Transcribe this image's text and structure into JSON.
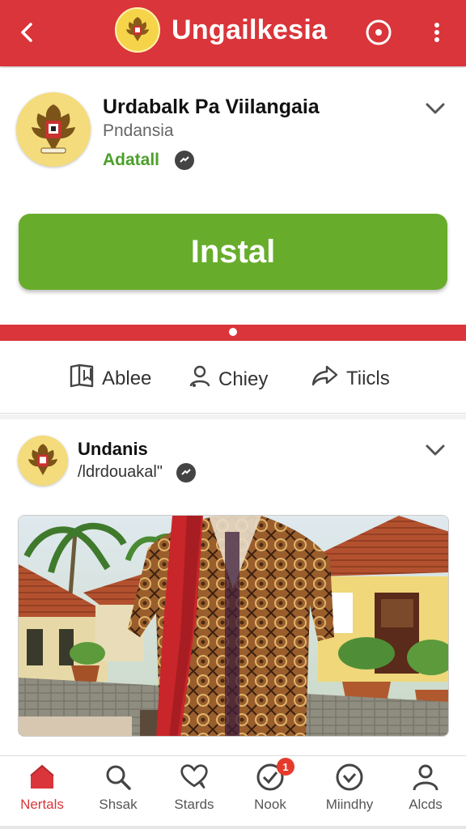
{
  "appbar": {
    "title": "Ungailkesia",
    "icons": [
      "back-arrow-icon",
      "garuda-emblem-icon",
      "record-icon",
      "more-vertical-icon"
    ]
  },
  "app": {
    "name": "Urdabalk Pa Viilangaia",
    "publisher": "Pndansia",
    "status": "Adatall",
    "install_label": "Instal"
  },
  "actions": [
    {
      "label": "Ablee",
      "icon": "bookmark-icon"
    },
    {
      "label": "Chiey",
      "icon": "person-icon"
    },
    {
      "label": "Tiicls",
      "icon": "share-icon"
    }
  ],
  "post": {
    "author": "Undanis",
    "handle": "/ldrdouakal\"",
    "image": "batik-shirt-photo"
  },
  "nav": {
    "items": [
      {
        "label": "Nertals",
        "icon": "home-icon",
        "active": true
      },
      {
        "label": "Shsak",
        "icon": "search-icon"
      },
      {
        "label": "Stards",
        "icon": "heart-chat-icon"
      },
      {
        "label": "Nook",
        "icon": "check-circle-icon",
        "badge": "1"
      },
      {
        "label": "Miindhy",
        "icon": "check-circle-icon"
      },
      {
        "label": "Alcds",
        "icon": "profile-icon"
      }
    ]
  },
  "colors": {
    "brand_red": "#d9353a",
    "install_green": "#67ad2b",
    "status_green": "#4ba02a"
  }
}
